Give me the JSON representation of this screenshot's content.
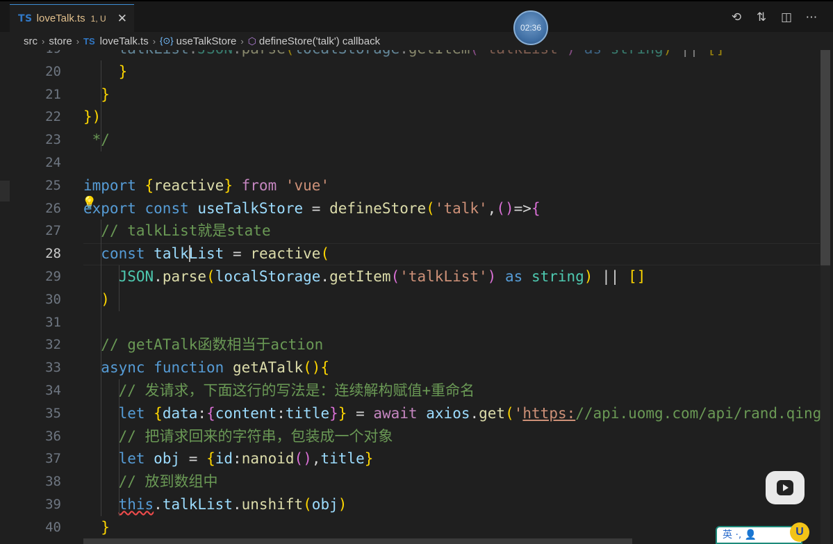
{
  "tab": {
    "lang_badge": "TS",
    "filename": "loveTalk.ts",
    "status": "1, U",
    "close": "✕"
  },
  "timer": {
    "text": "02:36"
  },
  "actions": [
    {
      "name": "timeline-icon",
      "glyph": "⟲"
    },
    {
      "name": "source-control-icon",
      "glyph": "⇅"
    },
    {
      "name": "split-editor-icon",
      "glyph": "◫"
    },
    {
      "name": "more-actions-icon",
      "glyph": "⋯"
    }
  ],
  "breadcrumb": {
    "parts": [
      "src",
      "store",
      "loveTalk.ts",
      "useTalkStore",
      "defineStore('talk') callback"
    ],
    "ts_badge": "TS",
    "sep": "›"
  },
  "gutter": {
    "active_line": 28,
    "numbers": [
      "19",
      "20",
      "21",
      "22",
      "23",
      "24",
      "25",
      "26",
      "27",
      "28",
      "29",
      "30",
      "31",
      "32",
      "33",
      "34",
      "35",
      "36",
      "37",
      "38",
      "39",
      "40"
    ]
  },
  "code_lines": [
    "    talkList:JSON.parse(localStorage.getItem('talkList') as string) || []",
    "    }",
    "  }",
    "})",
    " */",
    "",
    "import {reactive} from 'vue'",
    "export const useTalkStore = defineStore('talk',()=>{",
    "  // talkList就是state",
    "  const talkList = reactive(",
    "    JSON.parse(localStorage.getItem('talkList') as string) || []",
    "  )",
    "",
    "  // getATalk函数相当于action",
    "  async function getATalk(){",
    "    // 发请求，下面这行的写法是：连续解构赋值+重命名",
    "    let {data:{content:title}} = await axios.get('https://api.uomg.com/api/rand.qinghua?format=json')",
    "    // 把请求回来的字符串，包装成一个对象",
    "    let obj = {id:nanoid(),title}",
    "    // 放到数组中",
    "    this.talkList.unshift(obj)",
    "  }"
  ],
  "overlay": {
    "ime_text": "英 ·, 👤",
    "badge_text": "U"
  },
  "colors": {
    "keyword": "#569cd6",
    "control": "#c586c0",
    "function": "#dcdcaa",
    "variable": "#9cdcfe",
    "string": "#ce9178",
    "comment": "#6a9955"
  }
}
